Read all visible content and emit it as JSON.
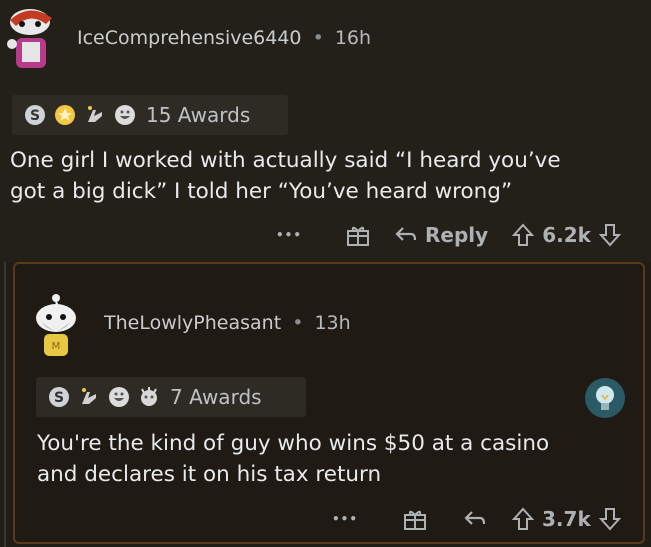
{
  "comment1": {
    "username": "IceComprehensive6440",
    "time": "16h",
    "awards_label": "15 Awards",
    "body_line1": "One girl I worked with actually said “I heard you’ve",
    "body_line2": "got a big dick” I told her “You’ve heard wrong”",
    "more": "•••",
    "reply_label": "Reply",
    "votes": "6.2k"
  },
  "comment2": {
    "username": "TheLowlyPheasant",
    "time": "13h",
    "awards_label": "7 Awards",
    "body_line1": "You're the kind of guy who wins $50 at a casino",
    "body_line2": "and declares it on his tax return",
    "more": "•••",
    "votes": "3.7k"
  },
  "separator": "•",
  "colors": {
    "highlight_border": "#5a3a18",
    "text": "#e8eaeb"
  }
}
